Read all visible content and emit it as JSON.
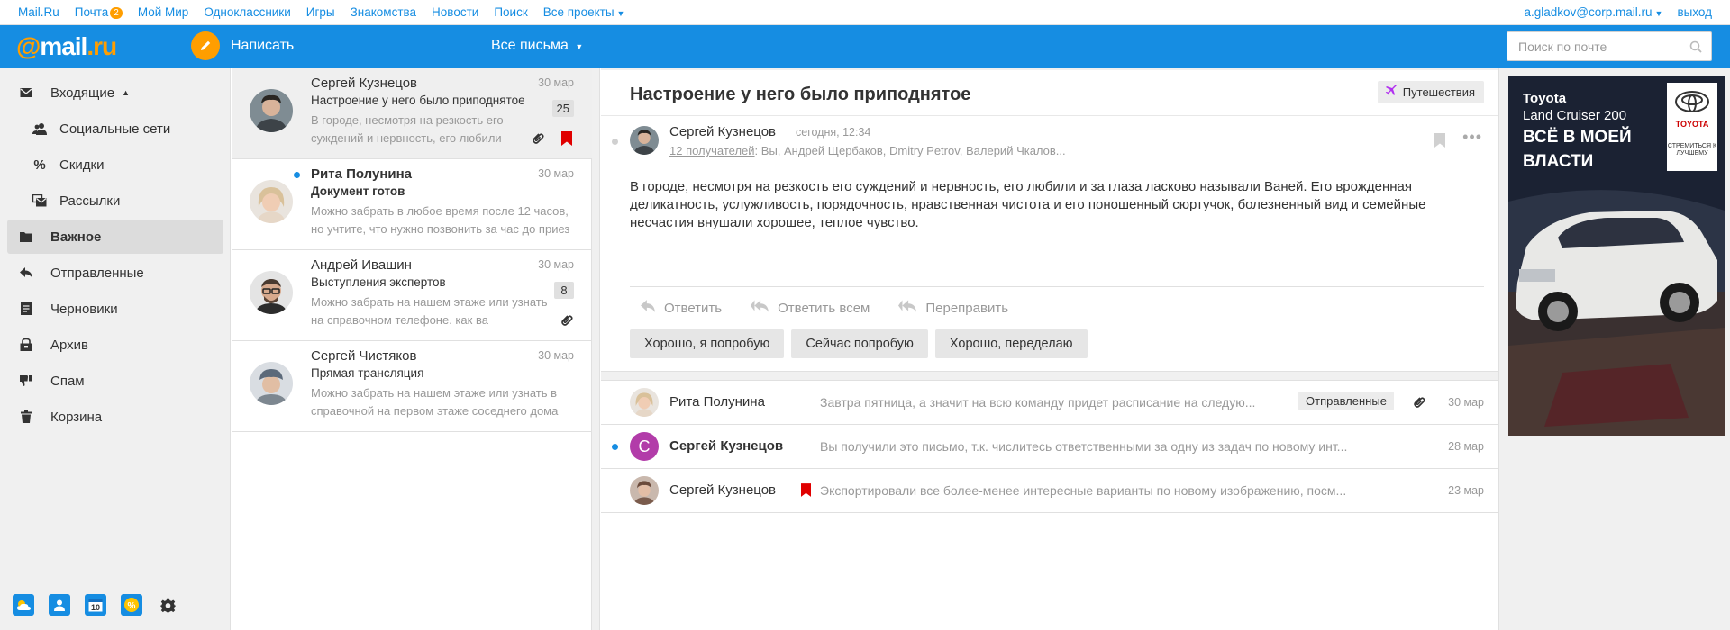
{
  "topnav": {
    "links": [
      "Mail.Ru",
      "Почта",
      "Мой Мир",
      "Одноклассники",
      "Игры",
      "Знакомства",
      "Новости",
      "Поиск",
      "Все проекты"
    ],
    "mail_badge": "2",
    "account": "a.gladkov@corp.mail.ru",
    "logout": "выход"
  },
  "header": {
    "logo_at": "@",
    "logo_mail": "mail",
    "logo_ru": ".ru",
    "write_label": "Написать",
    "all_mail_label": "Все письма",
    "search_placeholder": "Поиск по почте"
  },
  "sidebar": {
    "items": [
      {
        "label": "Входящие",
        "icon": "inbox-icon"
      },
      {
        "label": "Социальные сети",
        "icon": "people-icon"
      },
      {
        "label": "Скидки",
        "icon": "percent-icon"
      },
      {
        "label": "Рассылки",
        "icon": "newsletter-icon"
      },
      {
        "label": "Важное",
        "icon": "folder-icon"
      },
      {
        "label": "Отправленные",
        "icon": "sent-icon"
      },
      {
        "label": "Черновики",
        "icon": "drafts-icon"
      },
      {
        "label": "Архив",
        "icon": "archive-icon"
      },
      {
        "label": "Спам",
        "icon": "spam-icon"
      },
      {
        "label": "Корзина",
        "icon": "trash-icon"
      }
    ],
    "tools": [
      "weather-icon",
      "contacts-icon",
      "calendar-icon",
      "discount-icon",
      "settings-icon"
    ],
    "calendar_day": "10"
  },
  "messages": [
    {
      "from": "Сергей Кузнецов",
      "date": "30 мар",
      "subject": "Настроение у него было приподнятое",
      "snippet": "В городе, несмотря на резкость его суждений и нервность, его любили",
      "count": "25"
    },
    {
      "from": "Рита Полунина",
      "date": "30 мар",
      "subject": "Документ готов",
      "snippet": "Можно забрать в любое время после 12 часов, но учтите, что нужно позвонить за час до приез"
    },
    {
      "from": "Андрей Ивашин",
      "date": "30 мар",
      "subject": "Выступления экспертов",
      "snippet": "Можно забрать на нашем этаже или узнать на справочном телефоне. как ва",
      "count": "8"
    },
    {
      "from": "Сергей Чистяков",
      "date": "30 мар",
      "subject": "Прямая трансляция",
      "snippet": "Можно забрать на нашем этаже или узнать в справочной на первом этаже соседнего дома"
    }
  ],
  "letter": {
    "title": "Настроение у него было приподнятое",
    "tag": "Путешествия",
    "from": "Сергей Кузнецов",
    "time": "сегодня, 12:34",
    "recipients_link": "12 получателей",
    "recipients_list": ": Вы, Андрей Щербаков, Dmitry Petrov, Валерий Чкалов...",
    "body": "В городе, несмотря на резкость его суждений и нервность, его любили и за глаза ласково называли Ваней. Его врожденная деликатность, услужливость, порядочность, нравственная чистота и его поношенный сюртучок, болезненный вид и семейные несчастия внушали хорошее, теплое чувство.",
    "actions": [
      "Ответить",
      "Ответить всем",
      "Переправить"
    ],
    "quick_replies": [
      "Хорошо, я попробую",
      "Сейчас попробую",
      "Хорошо, переделаю"
    ]
  },
  "thread": [
    {
      "from": "Рита Полунина",
      "snippet": "Завтра пятница, а значит на всю команду придет расписание на следую...",
      "tag": "Отправленные",
      "date": "30 мар"
    },
    {
      "from": "Сергей Кузнецов",
      "initial": "С",
      "snippet": "Вы получили это письмо, т.к. числитесь ответственными за одну из задач по новому инт...",
      "date": "28 мар"
    },
    {
      "from": "Сергей Кузнецов",
      "snippet": "Экспортировали все более-менее интересные варианты по новому изображению, посм...",
      "date": "23 мар"
    }
  ],
  "ad": {
    "line1": "Toyota",
    "line2": "Land Cruiser 200",
    "line3a": "ВСЁ В МОЕЙ",
    "line3b": "ВЛАСТИ",
    "brand": "TOYOTA",
    "slogan": "СТРЕМИТЬСЯ К ЛУЧШЕМУ"
  },
  "colors": {
    "accent": "#168de2",
    "orange": "#ff9e00",
    "flag": "#e00000"
  }
}
